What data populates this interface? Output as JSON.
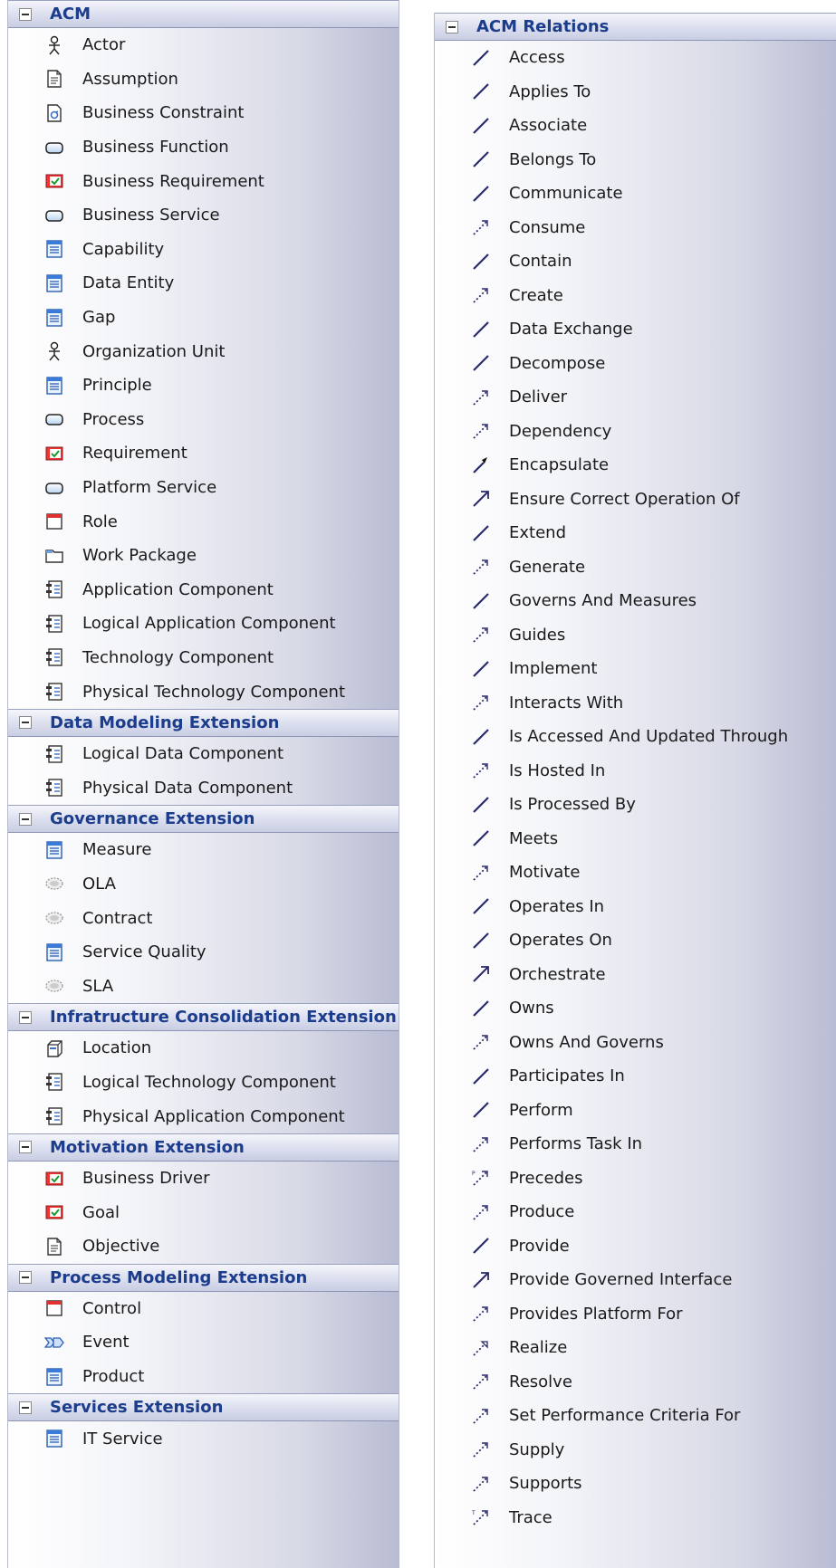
{
  "left_groups": [
    {
      "title": "ACM",
      "items": [
        {
          "label": "Actor",
          "icon": "actor-icon"
        },
        {
          "label": "Assumption",
          "icon": "document-icon"
        },
        {
          "label": "Business Constraint",
          "icon": "constraint-icon"
        },
        {
          "label": "Business Function",
          "icon": "rounded-rect-icon"
        },
        {
          "label": "Business Requirement",
          "icon": "requirement-icon"
        },
        {
          "label": "Business Service",
          "icon": "rounded-rect-icon"
        },
        {
          "label": "Capability",
          "icon": "class-icon"
        },
        {
          "label": "Data Entity",
          "icon": "class-icon"
        },
        {
          "label": "Gap",
          "icon": "class-icon"
        },
        {
          "label": "Organization Unit",
          "icon": "actor-icon"
        },
        {
          "label": "Principle",
          "icon": "class-icon"
        },
        {
          "label": "Process",
          "icon": "rounded-rect-icon"
        },
        {
          "label": "Requirement",
          "icon": "requirement-icon"
        },
        {
          "label": "Platform Service",
          "icon": "rounded-rect-icon"
        },
        {
          "label": "Role",
          "icon": "role-icon"
        },
        {
          "label": "Work Package",
          "icon": "package-icon"
        },
        {
          "label": "Application Component",
          "icon": "component-icon"
        },
        {
          "label": "Logical Application Component",
          "icon": "component-icon"
        },
        {
          "label": "Technology Component",
          "icon": "component-icon"
        },
        {
          "label": "Physical Technology Component",
          "icon": "component-icon"
        }
      ]
    },
    {
      "title": "Data Modeling Extension",
      "items": [
        {
          "label": "Logical Data Component",
          "icon": "component-icon"
        },
        {
          "label": "Physical Data Component",
          "icon": "component-icon"
        }
      ]
    },
    {
      "title": "Governance Extension",
      "items": [
        {
          "label": "Measure",
          "icon": "class-icon"
        },
        {
          "label": "OLA",
          "icon": "ellipse-icon"
        },
        {
          "label": "Contract",
          "icon": "ellipse-icon"
        },
        {
          "label": "Service Quality",
          "icon": "class-icon"
        },
        {
          "label": "SLA",
          "icon": "ellipse-icon"
        }
      ]
    },
    {
      "title": "Infratructure Consolidation Extension",
      "items": [
        {
          "label": "Location",
          "icon": "node-icon"
        },
        {
          "label": "Logical Technology Component",
          "icon": "component-icon"
        },
        {
          "label": "Physical Application Component",
          "icon": "component-icon"
        }
      ]
    },
    {
      "title": "Motivation Extension",
      "items": [
        {
          "label": "Business Driver",
          "icon": "requirement-icon"
        },
        {
          "label": "Goal",
          "icon": "requirement-icon"
        },
        {
          "label": "Objective",
          "icon": "document-icon"
        }
      ]
    },
    {
      "title": "Process Modeling Extension",
      "items": [
        {
          "label": "Control",
          "icon": "role-icon"
        },
        {
          "label": "Event",
          "icon": "event-icon"
        },
        {
          "label": "Product",
          "icon": "class-icon"
        }
      ]
    },
    {
      "title": "Services Extension",
      "items": [
        {
          "label": "IT Service",
          "icon": "class-icon"
        }
      ]
    }
  ],
  "right_group": {
    "title": "ACM Relations",
    "items": [
      {
        "label": "Access",
        "icon": "association-icon"
      },
      {
        "label": "Applies To",
        "icon": "association-icon"
      },
      {
        "label": "Associate",
        "icon": "association-icon"
      },
      {
        "label": "Belongs To",
        "icon": "association-icon"
      },
      {
        "label": "Communicate",
        "icon": "association-icon"
      },
      {
        "label": "Consume",
        "icon": "dependency-icon"
      },
      {
        "label": "Contain",
        "icon": "association-icon"
      },
      {
        "label": "Create",
        "icon": "dependency-icon"
      },
      {
        "label": "Data Exchange",
        "icon": "association-icon"
      },
      {
        "label": "Decompose",
        "icon": "association-icon"
      },
      {
        "label": "Deliver",
        "icon": "dependency-icon"
      },
      {
        "label": "Dependency",
        "icon": "dependency-icon"
      },
      {
        "label": "Encapsulate",
        "icon": "composition-icon"
      },
      {
        "label": "Ensure Correct Operation Of",
        "icon": "directed-association-icon"
      },
      {
        "label": "Extend",
        "icon": "association-icon"
      },
      {
        "label": "Generate",
        "icon": "dependency-icon"
      },
      {
        "label": "Governs And Measures",
        "icon": "association-icon"
      },
      {
        "label": "Guides",
        "icon": "dependency-icon"
      },
      {
        "label": "Implement",
        "icon": "association-icon"
      },
      {
        "label": "Interacts With",
        "icon": "dependency-icon"
      },
      {
        "label": "Is Accessed And Updated Through",
        "icon": "association-icon"
      },
      {
        "label": "Is Hosted In",
        "icon": "dependency-icon"
      },
      {
        "label": "Is Processed By",
        "icon": "association-icon"
      },
      {
        "label": "Meets",
        "icon": "association-icon"
      },
      {
        "label": "Motivate",
        "icon": "dependency-icon"
      },
      {
        "label": "Operates In",
        "icon": "association-icon"
      },
      {
        "label": "Operates On",
        "icon": "association-icon"
      },
      {
        "label": "Orchestrate",
        "icon": "directed-association-icon"
      },
      {
        "label": "Owns",
        "icon": "association-icon"
      },
      {
        "label": "Owns And Governs",
        "icon": "dependency-icon"
      },
      {
        "label": "Participates In",
        "icon": "association-icon"
      },
      {
        "label": "Perform",
        "icon": "association-icon"
      },
      {
        "label": "Performs Task In",
        "icon": "dependency-icon"
      },
      {
        "label": "Precedes",
        "icon": "precedes-icon"
      },
      {
        "label": "Produce",
        "icon": "dependency-icon"
      },
      {
        "label": "Provide",
        "icon": "association-icon"
      },
      {
        "label": "Provide Governed Interface",
        "icon": "directed-association-icon"
      },
      {
        "label": "Provides Platform For",
        "icon": "dependency-icon"
      },
      {
        "label": "Realize",
        "icon": "realize-icon"
      },
      {
        "label": "Resolve",
        "icon": "dependency-icon"
      },
      {
        "label": "Set Performance Criteria For",
        "icon": "dependency-icon"
      },
      {
        "label": "Supply",
        "icon": "dependency-icon"
      },
      {
        "label": "Supports",
        "icon": "dependency-icon"
      },
      {
        "label": "Trace",
        "icon": "trace-icon"
      }
    ]
  }
}
